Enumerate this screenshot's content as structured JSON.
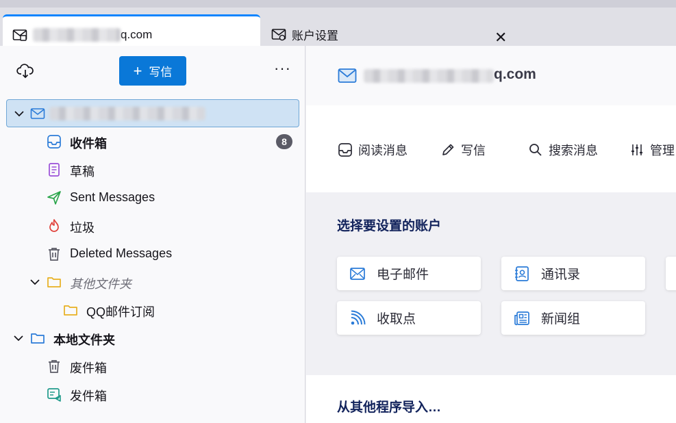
{
  "tabs": [
    {
      "title_suffix": "q.com",
      "icon": "mail-icon",
      "active": true
    },
    {
      "title": "账户设置",
      "icon": "mail-settings-icon",
      "active": false
    }
  ],
  "tab_close_label": "✕",
  "folder_pane": {
    "write_button_label": "写信",
    "more_label": "···",
    "account_row_icon": "mail-icon",
    "folders": [
      {
        "label": "收件箱",
        "icon": "inbox-icon",
        "bold": true,
        "unread": "8"
      },
      {
        "label": "草稿",
        "icon": "drafts-icon"
      },
      {
        "label": "Sent Messages",
        "icon": "sent-icon"
      },
      {
        "label": "垃圾",
        "icon": "junk-icon"
      },
      {
        "label": "Deleted Messages",
        "icon": "trash-icon"
      },
      {
        "label": "其他文件夹",
        "icon": "folder-icon",
        "italic": true
      },
      {
        "label": "QQ邮件订阅",
        "icon": "folder-icon"
      }
    ],
    "local_folders": {
      "label": "本地文件夹",
      "children": [
        {
          "label": "废件箱",
          "icon": "trash-icon"
        },
        {
          "label": "发件箱",
          "icon": "outbox-icon"
        }
      ]
    }
  },
  "account_central": {
    "account_name_suffix": "q.com",
    "actions": [
      {
        "label": "阅读消息",
        "icon": "inbox-icon"
      },
      {
        "label": "写信",
        "icon": "pencil-icon"
      },
      {
        "label": "搜索消息",
        "icon": "search-icon"
      },
      {
        "label": "管理",
        "icon": "sliders-icon"
      }
    ],
    "setup_title": "选择要设置的账户",
    "setup_cards": [
      {
        "label": "电子邮件",
        "icon": "mail-icon"
      },
      {
        "label": "通讯录",
        "icon": "address-book-icon"
      },
      {
        "label": "收取点",
        "icon": "rss-icon"
      },
      {
        "label": "新闻组",
        "icon": "newsgroup-icon"
      }
    ],
    "import_title": "从其他程序导入…"
  },
  "colors": {
    "accent": "#0a84ff",
    "write_button": "#0a78d8",
    "selected_row": "#cfe2f4",
    "heading": "#12235c"
  }
}
